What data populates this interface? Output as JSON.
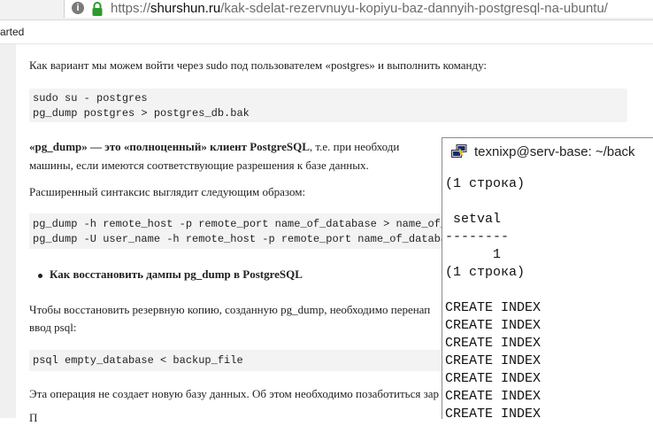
{
  "browser": {
    "url_prefix": "https://",
    "url_host": "shurshun.ru",
    "url_path": "/kak-sdelat-rezervnuyu-kopiyu-baz-dannyih-postgresql-na-ubuntu/",
    "bookmark_fragment": "arted"
  },
  "article": {
    "para1": "Как вариант мы можем войти через sudo под пользователем «postgres» и выполнить команду:",
    "code1": [
      "sudo su - postgres",
      "pg_dump postgres > postgres_db.bak"
    ],
    "para2_bold": "«pg_dump» — это «полноценный» клиент PostgreSQL",
    "para2_rest": ", т.е. при необходи",
    "para2_line2": "машины, если имеются соответствующие разрешения к базе данных.",
    "para3": "Расширенный синтаксис выглядит следующим образом:",
    "code2": [
      "pg_dump -h remote_host -p remote_port name_of_database > name_of_b",
      "pg_dump -U user_name -h remote_host -p remote_port name_of_databas"
    ],
    "heading": "Как восстановить дампы  pg_dump в PostgreSQL",
    "para4_line1": "Чтобы восстановить резервную копию, созданную pg_dump, необходимо перенап",
    "para4_line2": "ввод psql:",
    "code3": [
      "psql empty_database < backup_file"
    ],
    "para5": "Эта операция не создает новую базу данных. Об этом необходимо позаботиться зар",
    "para6_partial": "П"
  },
  "terminal": {
    "title": "texnixp@serv-base: ~/back",
    "lines": [
      "(1 строка)",
      "",
      " setval",
      "--------",
      "      1",
      "(1 строка)",
      "",
      "CREATE INDEX",
      "CREATE INDEX",
      "CREATE INDEX",
      "CREATE INDEX",
      "CREATE INDEX",
      "CREATE INDEX",
      "CREATE INDEX"
    ]
  }
}
